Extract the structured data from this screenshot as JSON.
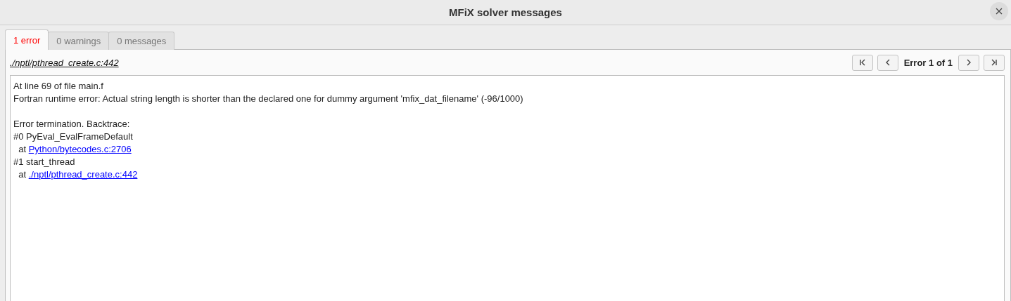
{
  "window": {
    "title": "MFiX solver messages"
  },
  "tabs": [
    {
      "label": "1 error",
      "selected": true,
      "kind": "error"
    },
    {
      "label": "0 warnings",
      "selected": false,
      "kind": "warning"
    },
    {
      "label": "0 messages",
      "selected": false,
      "kind": "message"
    }
  ],
  "location": "./nptl/pthread_create.c:442",
  "navigator": {
    "counter": "Error 1 of 1"
  },
  "message": [
    {
      "kind": "text",
      "text": "At line 69 of file main.f"
    },
    {
      "kind": "text",
      "text": "Fortran runtime error: Actual string length is shorter than the declared one for dummy argument 'mfix_dat_filename' (-96/1000)"
    },
    {
      "kind": "blank"
    },
    {
      "kind": "text",
      "text": "Error termination. Backtrace:"
    },
    {
      "kind": "text",
      "text": "#0 PyEval_EvalFrameDefault"
    },
    {
      "kind": "link",
      "prefix": "at",
      "link": "Python/bytecodes.c:2706"
    },
    {
      "kind": "text",
      "text": "#1 start_thread"
    },
    {
      "kind": "link",
      "prefix": "at",
      "link": "./nptl/pthread_create.c:442"
    }
  ]
}
